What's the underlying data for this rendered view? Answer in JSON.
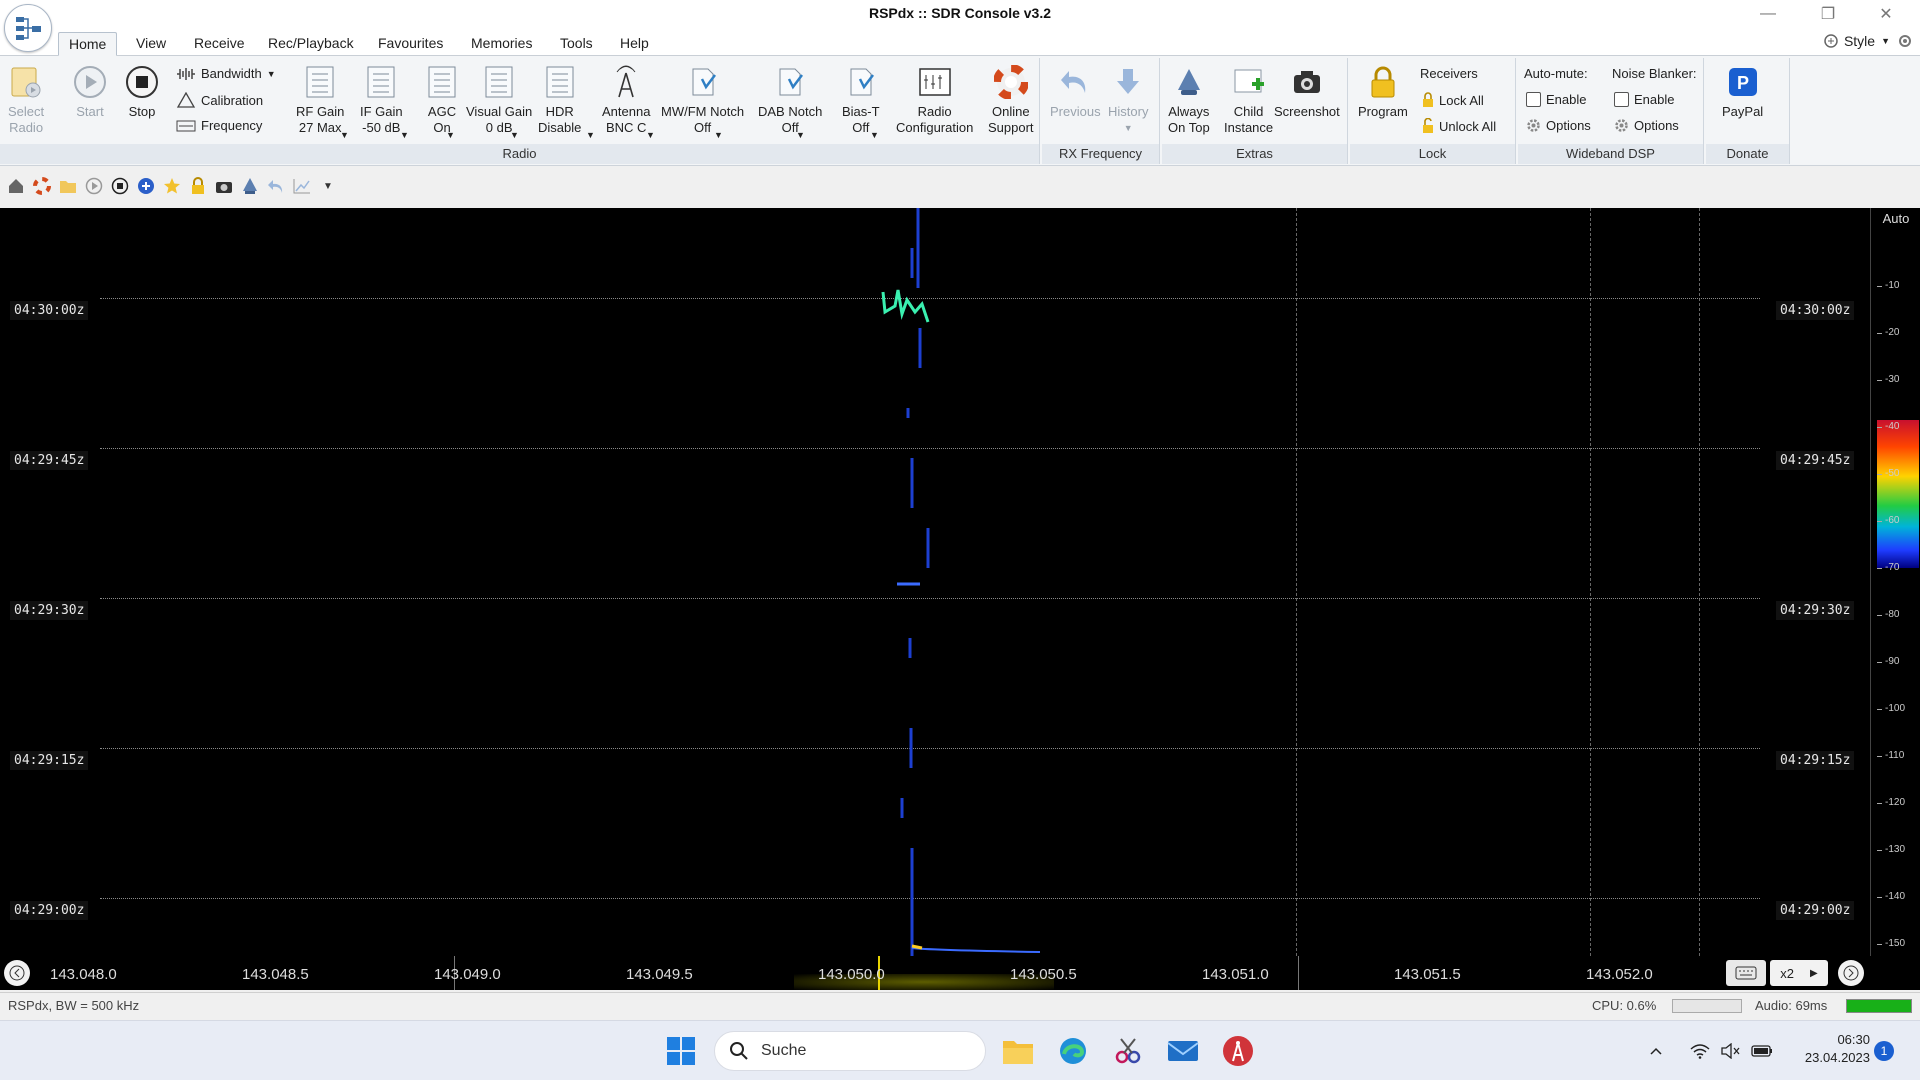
{
  "window": {
    "title": "RSPdx :: SDR Console v3.2",
    "minimize": "—",
    "restore": "❐",
    "close": "✕"
  },
  "menu": {
    "tabs": [
      "Home",
      "View",
      "Receive",
      "Rec/Playback",
      "Favourites",
      "Memories",
      "Tools",
      "Help"
    ],
    "active": "Home",
    "style_label": "Style"
  },
  "ribbon": {
    "select_radio": [
      "Select",
      "Radio"
    ],
    "start": "Start",
    "stop": "Stop",
    "bandwidth": "Bandwidth",
    "calibration": "Calibration",
    "frequency": "Frequency",
    "rf_gain": [
      "RF Gain",
      "27 Max"
    ],
    "if_gain": [
      "IF Gain",
      "-50 dB"
    ],
    "agc": [
      "AGC",
      "On"
    ],
    "visual_gain": [
      "Visual Gain",
      "0 dB"
    ],
    "hdr": [
      "HDR",
      "Disable"
    ],
    "antenna": [
      "Antenna",
      "BNC C"
    ],
    "mwfm_notch": [
      "MW/FM Notch",
      "Off"
    ],
    "dab_notch": [
      "DAB Notch",
      "Off"
    ],
    "bias_t": [
      "Bias-T",
      "Off"
    ],
    "radio_config": [
      "Radio",
      "Configuration"
    ],
    "online_support": [
      "Online",
      "Support"
    ],
    "group_radio": "Radio",
    "previous": "Previous",
    "history": "History",
    "group_rx": "RX Frequency",
    "always_on_top": [
      "Always",
      "On Top"
    ],
    "child_instance": [
      "Child",
      "Instance"
    ],
    "screenshot": "Screenshot",
    "group_extras": "Extras",
    "program": "Program",
    "receivers": "Receivers",
    "lock_all": "Lock All",
    "unlock_all": "Unlock All",
    "group_lock": "Lock",
    "auto_mute": "Auto-mute:",
    "noise_blanker": "Noise Blanker:",
    "enable_1": "Enable",
    "enable_2": "Enable",
    "options_1": "Options",
    "options_2": "Options",
    "group_wideband": "Wideband DSP",
    "paypal": "PayPal",
    "group_donate": "Donate"
  },
  "waterfall": {
    "times": [
      "04:30:00z",
      "04:29:45z",
      "04:29:30z",
      "04:29:15z",
      "04:29:00z"
    ],
    "scale_auto": "Auto",
    "scale_ticks": [
      "-10",
      "-20",
      "-30",
      "-40",
      "-50",
      "-60",
      "-70",
      "-80",
      "-90",
      "-100",
      "-110",
      "-120",
      "-130",
      "-140",
      "-150"
    ]
  },
  "freq_axis": {
    "labels": [
      "143.048.0",
      "143.048.5",
      "143.049.0",
      "143.049.5",
      "143.050.0",
      "143.050.5",
      "143.051.0",
      "143.051.5",
      "143.052.0"
    ],
    "zoom": "x2"
  },
  "status": {
    "left": "RSPdx, BW = 500 kHz",
    "cpu": "CPU: 0.6%",
    "audio": "Audio: 69ms",
    "audio_level": 1.0
  },
  "taskbar": {
    "search_placeholder": "Suche",
    "time": "06:30",
    "date": "23.04.2023",
    "notifications": "1"
  },
  "colors": {
    "accent": "#1a5fd0",
    "signal": "#4fd1ff",
    "audio_bar": "#18b018"
  }
}
